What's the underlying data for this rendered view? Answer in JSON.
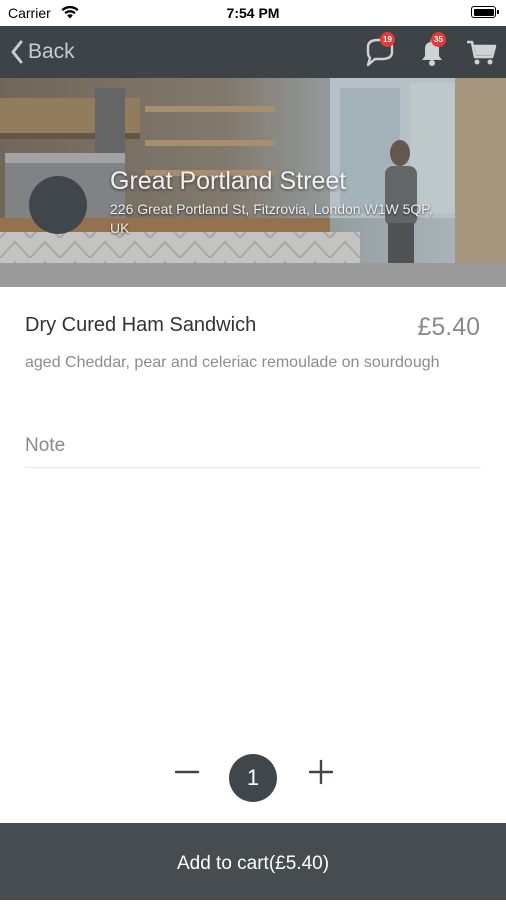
{
  "status_bar": {
    "carrier": "Carrier",
    "time": "7:54 PM"
  },
  "nav": {
    "back_label": "Back",
    "messages_badge": "19",
    "notifications_badge": "35"
  },
  "store": {
    "name": "Great Portland Street",
    "address": "226 Great Portland St, Fitzrovia, London W1W 5QP, UK"
  },
  "product": {
    "name": "Dry Cured Ham Sandwich",
    "price": "£5.40",
    "description": "aged Cheddar, pear and celeriac remoulade on sourdough"
  },
  "note": {
    "placeholder": "Note",
    "value": ""
  },
  "quantity": {
    "value": "1"
  },
  "cart_button": {
    "label": "Add to cart(£5.40)"
  },
  "colors": {
    "nav_background": "#3d4347",
    "badge": "#e23a3a",
    "button_background": "#464c50",
    "price_text": "#8a8a8a"
  },
  "icons": {
    "back": "chevron-left-icon",
    "messages": "chat-bubble-icon",
    "notifications": "bell-icon",
    "cart": "shopping-cart-icon",
    "minus": "minus-icon",
    "plus": "plus-icon"
  }
}
